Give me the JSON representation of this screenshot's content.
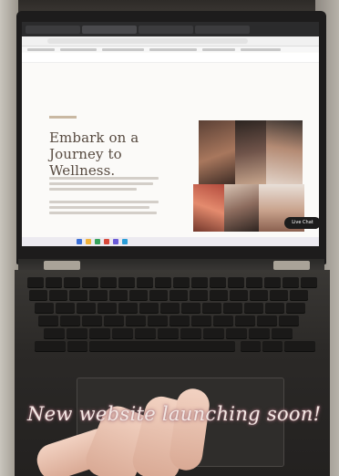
{
  "website": {
    "hero_title": "Embark on a Journey to Wellness.",
    "chat_button": "Live Chat"
  },
  "overlay": {
    "caption": "New website launching soon!"
  },
  "colors": {
    "caption_glow": "#b27b87",
    "hero_text": "#574a40"
  }
}
